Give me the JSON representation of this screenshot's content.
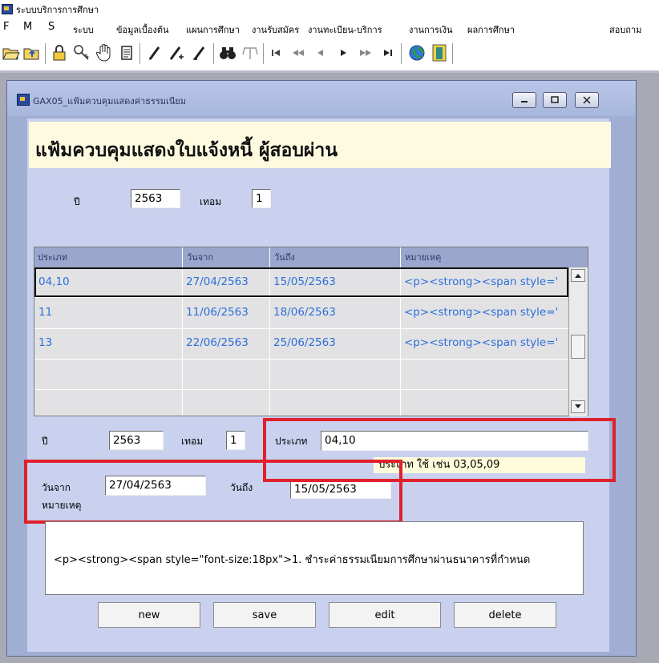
{
  "app": {
    "title": "ระบบบริการการศึกษา"
  },
  "menu": {
    "items": [
      "F",
      "M",
      "S",
      "ระบบ",
      "ข้อมูลเบื้องต้น",
      "แผนการศึกษา",
      "งานรับสมัคร",
      "งานทะเบียน-บริการ",
      "งานการเงิน",
      "ผลการศึกษา",
      "สอบถาม"
    ]
  },
  "toolbar": {
    "icons": [
      "open-folder-icon",
      "upload-folder-icon",
      "lock-icon",
      "key-icon",
      "hand-icon",
      "document-icon",
      "pen-icon",
      "pen-add-icon",
      "pen-delete-icon",
      "binoculars-icon",
      "filter-icon",
      "first-record-icon",
      "prev-page-icon",
      "prev-record-icon",
      "next-record-icon",
      "next-page-icon",
      "last-record-icon",
      "globe-icon",
      "exit-door-icon"
    ]
  },
  "window": {
    "title": "GAX05_แฟ้มควบคุมแสดงค่าธรรมเนียม"
  },
  "form": {
    "heading": "แฟ้มควบคุมแสดงใบแจ้งหนี้ ผู้สอบผ่าน",
    "year_label": "ปี",
    "year_value": "2563",
    "term_label": "เทอม",
    "term_value": "1"
  },
  "grid": {
    "columns": [
      "ประเภท",
      "วันจาก",
      "วันถึง",
      "หมายเหตุ"
    ],
    "rows": [
      {
        "type": "04,10",
        "from": "27/04/2563",
        "to": "15/05/2563",
        "note": "<p><strong><span style='"
      },
      {
        "type": "11",
        "from": "11/06/2563",
        "to": "18/06/2563",
        "note": "<p><strong><span style='"
      },
      {
        "type": "13",
        "from": "22/06/2563",
        "to": "25/06/2563",
        "note": "<p><strong><span style='"
      }
    ]
  },
  "detail": {
    "year_label": "ปี",
    "year_value": "2563",
    "term_label": "เทอม",
    "term_value": "1",
    "type_label": "ประเภท",
    "type_value": "04,10",
    "type_hint": "ประเภท ใช้ เช่น 03,05,09",
    "from_label": "วันจาก",
    "from_value": "27/04/2563",
    "to_label": "วันถึง",
    "to_value": "15/05/2563",
    "remark_label": "หมายเหตุ",
    "remark_value": "<p><strong><span style=\"font-size:18px\">1. ชำระค่าธรรมเนียมการศึกษาผ่านธนาคารที่กำหนด"
  },
  "buttons": {
    "new": "new",
    "save": "save",
    "edit": "edit",
    "delete": "delete"
  },
  "colors": {
    "window_bg": "#a0aed4",
    "form_bg": "#c9d1ef",
    "heading_bg": "#fdfae0",
    "grid_text": "#2d6fd9",
    "highlight_red": "#e0202b"
  }
}
